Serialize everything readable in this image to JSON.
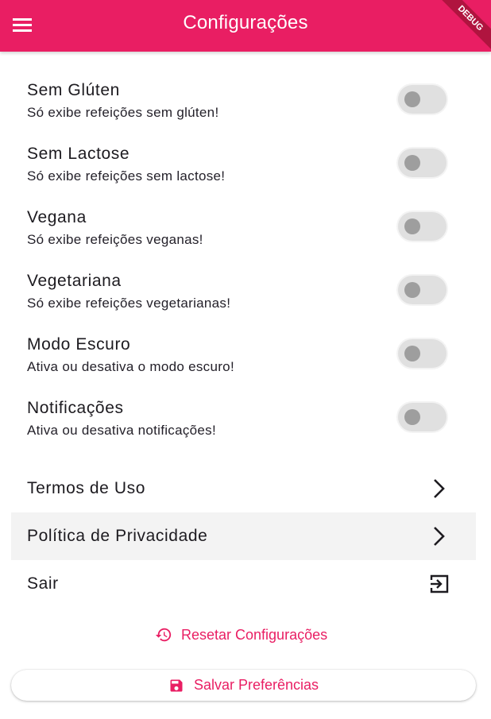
{
  "appbar": {
    "title": "Configurações",
    "debug_label": "DEBUG",
    "color": "#e91e63"
  },
  "preferences": [
    {
      "title": "Sem Glúten",
      "subtitle": "Só exibe refeições sem glúten!",
      "enabled": false
    },
    {
      "title": "Sem Lactose",
      "subtitle": "Só exibe refeições sem lactose!",
      "enabled": false
    },
    {
      "title": "Vegana",
      "subtitle": "Só exibe refeições veganas!",
      "enabled": false
    },
    {
      "title": "Vegetariana",
      "subtitle": "Só exibe refeições vegetarianas!",
      "enabled": false
    },
    {
      "title": "Modo Escuro",
      "subtitle": "Ativa ou desativa o modo escuro!",
      "enabled": false
    },
    {
      "title": "Notificações",
      "subtitle": "Ativa ou desativa notificações!",
      "enabled": false
    }
  ],
  "links": [
    {
      "label": "Termos de Uso",
      "icon": "chevron-right-icon"
    },
    {
      "label": "Política de Privacidade",
      "icon": "chevron-right-icon"
    },
    {
      "label": "Sair",
      "icon": "exit-icon"
    }
  ],
  "actions": {
    "reset_label": "Resetar Configurações",
    "reset_icon": "history-icon",
    "save_label": "Salvar Preferências",
    "save_icon": "save-icon"
  }
}
